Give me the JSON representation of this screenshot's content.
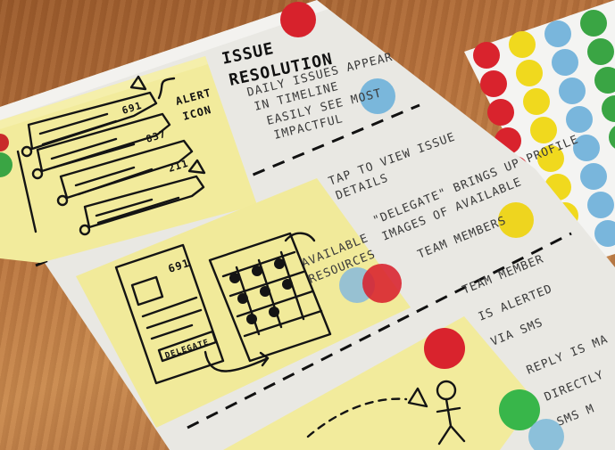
{
  "title_lines": [
    "ISSUE",
    "RESOLUTION"
  ],
  "section1_bullets": [
    "DAILY ISSUES APPEAR",
    "IN TIMELINE",
    "EASILY SEE MOST",
    "IMPACTFUL"
  ],
  "section2_bullets": [
    "TAP TO VIEW ISSUE",
    "DETAILS",
    "\"DELEGATE\" BRINGS UP PROFILE",
    "IMAGES OF AVAILABLE",
    "TEAM MEMBERS"
  ],
  "section3_bullets": [
    "TEAM MEMBER",
    "IS ALERTED",
    "VIA SMS",
    "REPLY IS MA",
    "DIRECTLY",
    "SMS M"
  ],
  "note1": {
    "alert_label_1": "ALERT",
    "alert_label_2": "ICON",
    "num1": "691",
    "num2": "837",
    "num3": "211"
  },
  "note2": {
    "num": "691",
    "button": "DELEGATE",
    "available_1": "AVAILABLE",
    "available_2": "RESOURCES"
  },
  "colors": {
    "paper": "#ecebe7",
    "sticky": "#f3eca0",
    "dot_red": "#d9232d",
    "dot_blue": "#79b6dc",
    "dot_yellow": "#f0d91e",
    "dot_green": "#3aa544"
  }
}
